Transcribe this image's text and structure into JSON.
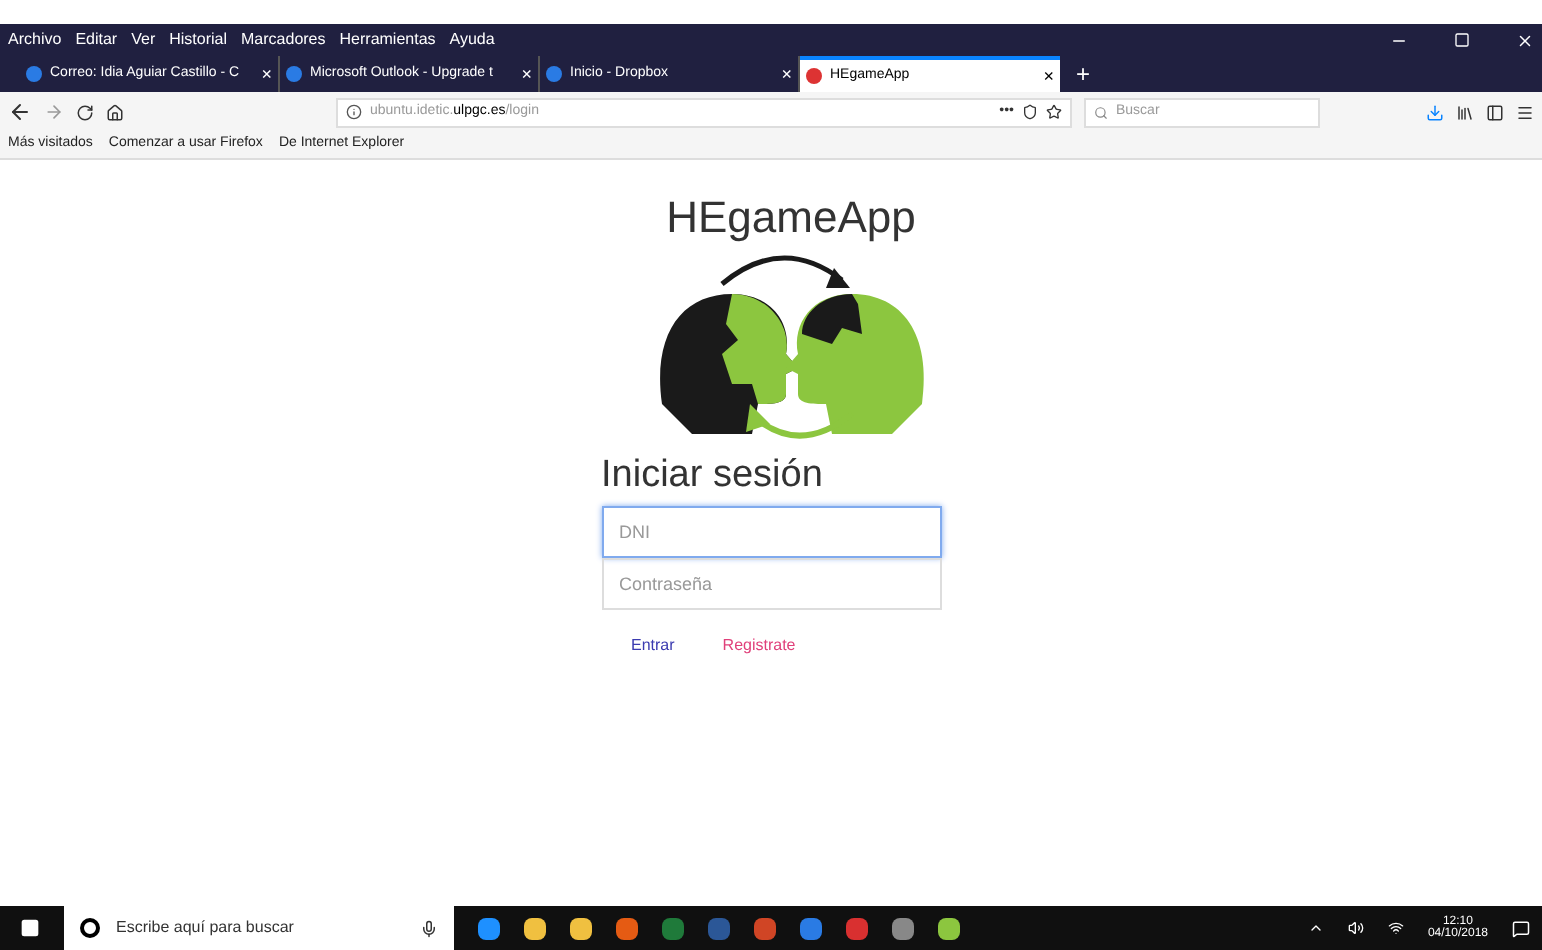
{
  "menu_bar": [
    "Archivo",
    "Editar",
    "Ver",
    "Historial",
    "Marcadores",
    "Herramientas",
    "Ayuda"
  ],
  "tabs": [
    {
      "label": "Correo: Idia Aguiar Castillo - C",
      "selected": false,
      "close": "×"
    },
    {
      "label": "Microsoft Outlook - Upgrade t",
      "selected": false,
      "close": "×"
    },
    {
      "label": "Inicio - Dropbox",
      "selected": false,
      "close": "×"
    },
    {
      "label": "HEgameApp",
      "selected": true,
      "close": "×"
    }
  ],
  "new_tab": "+",
  "address_bar": {
    "url_host": "ubuntu.idetic.",
    "url_domain": "ulpgc.es",
    "url_path": "/login",
    "more": "•••"
  },
  "search": {
    "placeholder": "Buscar"
  },
  "bookmarks": [
    "Más visitados",
    "Comenzar a usar Firefox",
    "De Internet Explorer"
  ],
  "page": {
    "app_title": "HEgameApp",
    "heading": "Iniciar sesión",
    "fields": [
      {
        "placeholder": "DNI",
        "focused": true
      },
      {
        "placeholder": "Contraseña",
        "focused": false
      }
    ],
    "links": [
      {
        "label": "Entrar",
        "color": "#3b3bb0"
      },
      {
        "label": "Registrate",
        "color": "#e0407a"
      }
    ]
  },
  "taskbar": {
    "search_placeholder": "Escribe aquí para buscar",
    "time": "12:10",
    "date": "04/10/2018"
  }
}
